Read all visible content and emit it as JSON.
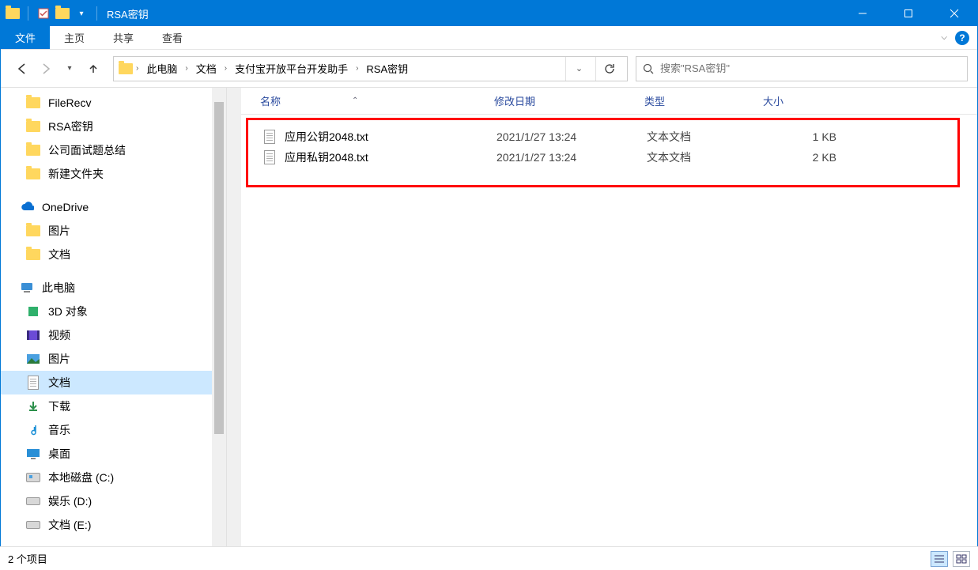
{
  "window": {
    "title": "RSA密钥"
  },
  "ribbon": {
    "file": "文件",
    "tabs": [
      "主页",
      "共享",
      "查看"
    ]
  },
  "nav": {
    "breadcrumb": [
      "此电脑",
      "文档",
      "支付宝开放平台开发助手",
      "RSA密钥"
    ],
    "search_placeholder": "搜索\"RSA密钥\""
  },
  "tree": {
    "quick": [
      {
        "label": "FileRecv",
        "icon": "folder"
      },
      {
        "label": "RSA密钥",
        "icon": "folder"
      },
      {
        "label": "公司面试题总结",
        "icon": "folder"
      },
      {
        "label": "新建文件夹",
        "icon": "folder"
      }
    ],
    "onedrive": {
      "label": "OneDrive",
      "children": [
        {
          "label": "图片",
          "icon": "folder"
        },
        {
          "label": "文档",
          "icon": "folder"
        }
      ]
    },
    "thispc": {
      "label": "此电脑",
      "children": [
        {
          "label": "3D 对象",
          "icon": "3d"
        },
        {
          "label": "视频",
          "icon": "video"
        },
        {
          "label": "图片",
          "icon": "picture"
        },
        {
          "label": "文档",
          "icon": "doc",
          "selected": true
        },
        {
          "label": "下载",
          "icon": "download"
        },
        {
          "label": "音乐",
          "icon": "music"
        },
        {
          "label": "桌面",
          "icon": "desktop"
        },
        {
          "label": "本地磁盘 (C:)",
          "icon": "drive"
        },
        {
          "label": "娱乐 (D:)",
          "icon": "drive"
        },
        {
          "label": "文档 (E:)",
          "icon": "drive"
        }
      ]
    }
  },
  "columns": {
    "name": "名称",
    "date": "修改日期",
    "type": "类型",
    "size": "大小"
  },
  "files": [
    {
      "name": "应用公钥2048.txt",
      "date": "2021/1/27 13:24",
      "type": "文本文档",
      "size": "1 KB"
    },
    {
      "name": "应用私钥2048.txt",
      "date": "2021/1/27 13:24",
      "type": "文本文档",
      "size": "2 KB"
    }
  ],
  "status": {
    "count": "2 个项目"
  }
}
